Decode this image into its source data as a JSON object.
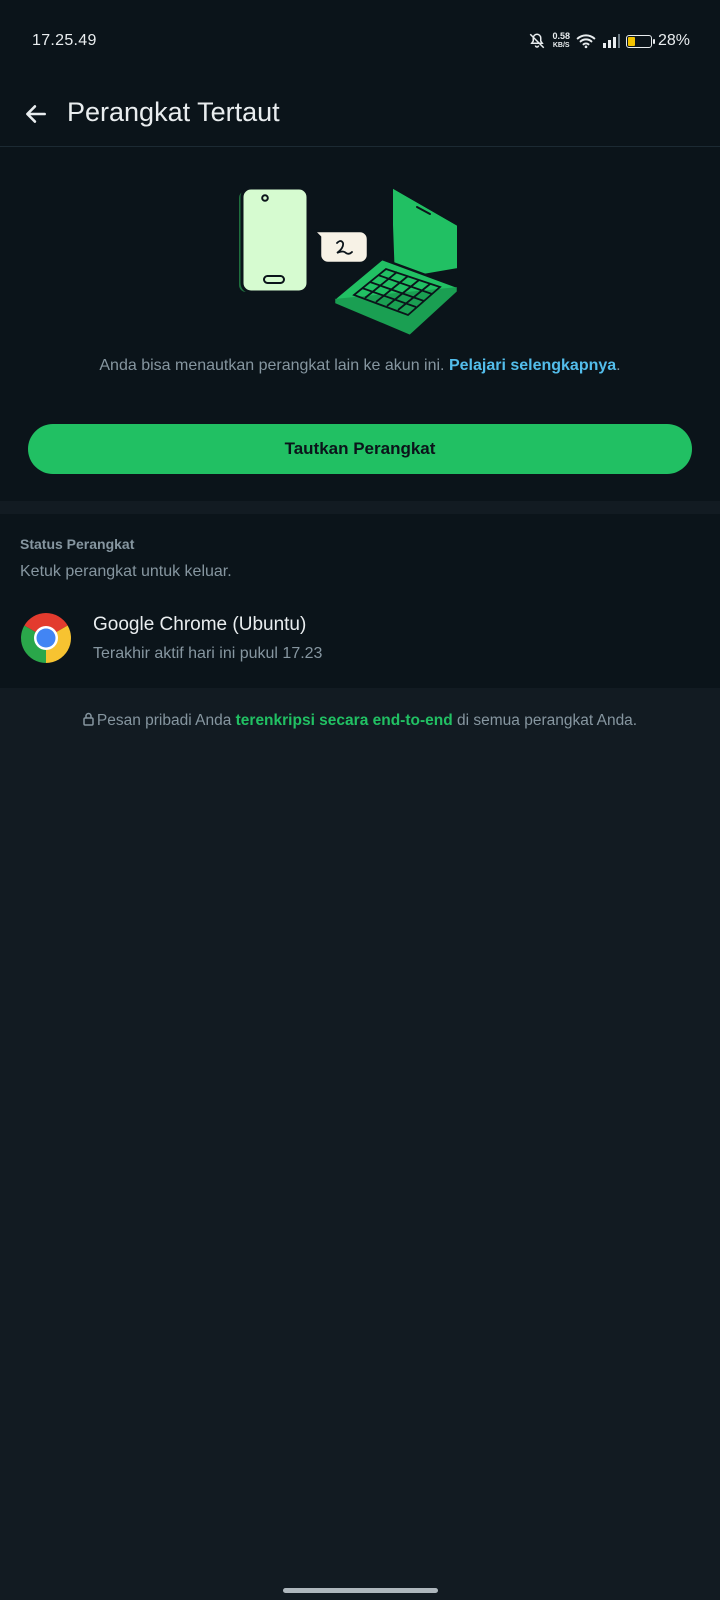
{
  "status_bar": {
    "time": "17.25.49",
    "net_speed_value": "0.58",
    "net_speed_unit": "KB/S",
    "battery_percent": "28%",
    "battery_level": 0.28,
    "icons": [
      "mute-icon",
      "wifi-icon",
      "signal-icon",
      "battery-icon"
    ]
  },
  "header": {
    "title": "Perangkat Tertaut"
  },
  "hero": {
    "description": "Anda bisa menautkan perangkat lain ke akun ini.",
    "learn_more": "Pelajari selengkapnya",
    "suffix": ".",
    "link_button": "Tautkan Perangkat"
  },
  "devices": {
    "header": "Status Perangkat",
    "subtitle": "Ketuk perangkat untuk keluar.",
    "items": [
      {
        "name": "Google Chrome (Ubuntu)",
        "status": "Terakhir aktif hari ini pukul 17.23",
        "icon": "chrome-icon"
      }
    ]
  },
  "encryption": {
    "prefix": "Pesan pribadi Anda",
    "link": "terenkripsi secara end-to-end",
    "suffix": "di semua perangkat Anda."
  },
  "colors": {
    "background": "#121b22",
    "surface": "#0b141a",
    "accent_green": "#21c063",
    "link_blue": "#53bdeb",
    "secondary_text": "#8696a0"
  }
}
